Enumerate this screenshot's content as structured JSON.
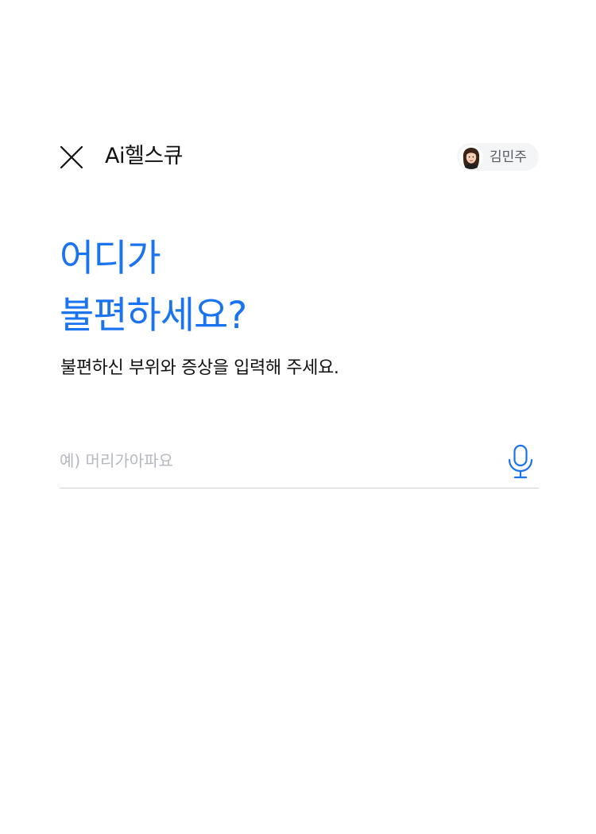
{
  "header": {
    "title": "Ai헬스큐",
    "user_name": "김민주"
  },
  "main": {
    "headline_line1": "어디가",
    "headline_line2": "불편하세요?",
    "subtitle": "불편하신 부위와 증상을 입력해 주세요."
  },
  "search": {
    "placeholder": "예) 머리가아파요",
    "value": ""
  },
  "icons": {
    "close": "close-icon",
    "avatar": "avatar",
    "microphone": "microphone-icon"
  },
  "colors": {
    "accent": "#1a73f0",
    "text": "#111111",
    "placeholder": "#b5b9bf",
    "chip_background": "#f4f5f7",
    "divider": "#cfd2d6"
  }
}
